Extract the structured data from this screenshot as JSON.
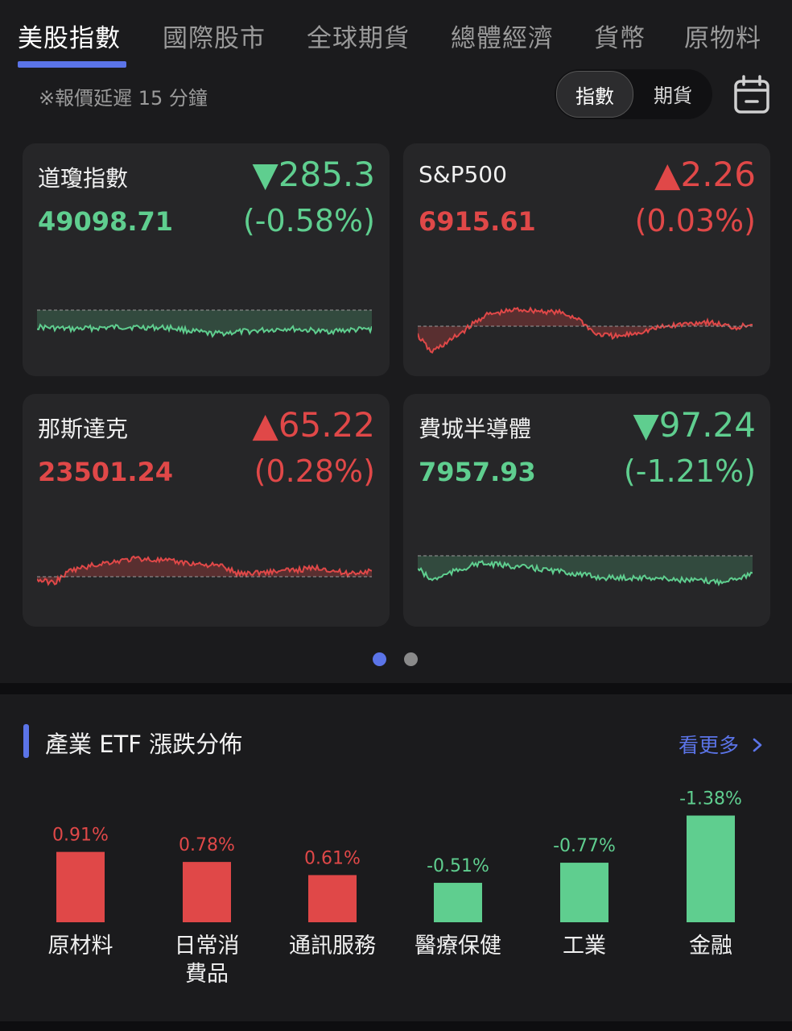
{
  "tabs": [
    "美股指數",
    "國際股市",
    "全球期貨",
    "總體經濟",
    "貨幣",
    "原物料"
  ],
  "delay_note": "※報價延遲 15 分鐘",
  "segment": {
    "index": "指數",
    "futures": "期貨"
  },
  "icons": {
    "calendar": "calendar-icon",
    "chevron": "chevron-right-icon",
    "up": "up-triangle",
    "down": "down-triangle"
  },
  "colors": {
    "accent": "#5b74e8",
    "up": "#e04848",
    "down": "#5fce8f",
    "card_bg": "#262628"
  },
  "cards": [
    {
      "name": "道瓊指數",
      "change": "▼285.3",
      "value": "49098.71",
      "pct": "(-0.58%)",
      "direction": "down"
    },
    {
      "name": "S&P500",
      "change": "▲2.26",
      "value": "6915.61",
      "pct": "(0.03%)",
      "direction": "up"
    },
    {
      "name": "那斯達克",
      "change": "▲65.22",
      "value": "23501.24",
      "pct": "(0.28%)",
      "direction": "up"
    },
    {
      "name": "費城半導體",
      "change": "▼97.24",
      "value": "7957.93",
      "pct": "(-1.21%)",
      "direction": "down"
    }
  ],
  "pagination": {
    "pages": 2,
    "active": 0
  },
  "section": {
    "title": "產業 ETF 漲跌分佈",
    "more": "看更多"
  },
  "chart_data": {
    "type": "bar",
    "categories": [
      "原材料",
      "日常消費品",
      "通訊服務",
      "醫療保健",
      "工業",
      "金融"
    ],
    "category_display": [
      "原材料",
      "日常消\n費品",
      "通訊服務",
      "醫療保健",
      "工業",
      "金融"
    ],
    "values": [
      0.91,
      0.78,
      0.61,
      -0.51,
      -0.77,
      -1.38
    ],
    "labels": [
      "0.91%",
      "0.78%",
      "0.61%",
      "-0.51%",
      "-0.77%",
      "-1.38%"
    ],
    "bars": "magnitude"
  }
}
